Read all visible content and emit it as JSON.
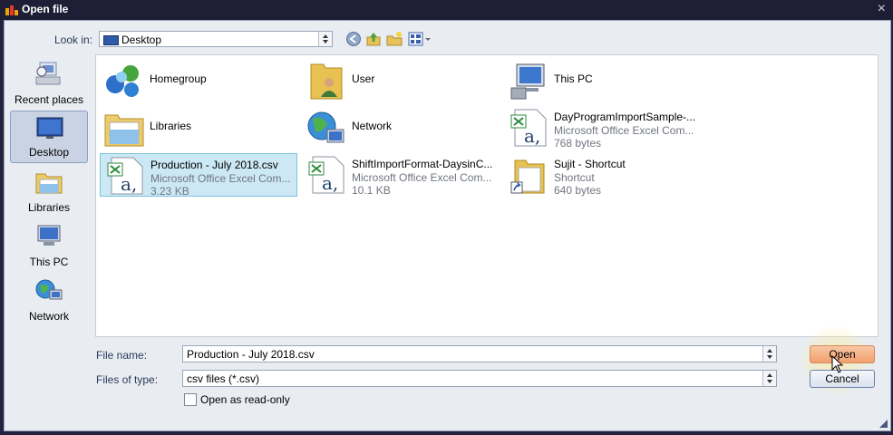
{
  "window": {
    "title": "Open file",
    "close_glyph": "×"
  },
  "lookin": {
    "label": "Look in:",
    "value": "Desktop"
  },
  "toolbar": {
    "back_icon": "back-icon",
    "up_icon": "up-folder-icon",
    "new_icon": "new-folder-icon",
    "view_icon": "view-menu-icon"
  },
  "places": [
    {
      "label": "Recent places",
      "icon": "recent-places-icon"
    },
    {
      "label": "Desktop",
      "icon": "desktop-icon"
    },
    {
      "label": "Libraries",
      "icon": "libraries-icon"
    },
    {
      "label": "This PC",
      "icon": "computer-icon"
    },
    {
      "label": "Network",
      "icon": "network-icon"
    }
  ],
  "files": [
    {
      "name": "Homegroup",
      "line2": "",
      "line3": "",
      "icon": "homegroup-icon"
    },
    {
      "name": "User",
      "line2": "",
      "line3": "",
      "icon": "user-folder-icon"
    },
    {
      "name": "This PC",
      "line2": "",
      "line3": "",
      "icon": "computer-icon"
    },
    {
      "name": "Libraries",
      "line2": "",
      "line3": "",
      "icon": "libraries-icon"
    },
    {
      "name": "Network",
      "line2": "",
      "line3": "",
      "icon": "network-icon"
    },
    {
      "name": "DayProgramImportSample-...",
      "line2": "Microsoft Office Excel Com...",
      "line3": "768 bytes",
      "icon": "excel-csv-icon"
    },
    {
      "name": "Production - July 2018.csv",
      "line2": "Microsoft Office Excel Com...",
      "line3": "3.23 KB",
      "icon": "excel-csv-icon"
    },
    {
      "name": "ShiftImportFormat-DaysinC...",
      "line2": "Microsoft Office Excel Com...",
      "line3": "10.1 KB",
      "icon": "excel-csv-icon"
    },
    {
      "name": "Sujit - Shortcut",
      "line2": "Shortcut",
      "line3": "640 bytes",
      "icon": "shortcut-icon"
    }
  ],
  "filename": {
    "label": "File name:",
    "value": "Production - July 2018.csv"
  },
  "filetype": {
    "label": "Files of type:",
    "value": "csv files (*.csv)"
  },
  "readonly": {
    "label": "Open as read-only",
    "checked": false
  },
  "buttons": {
    "open": "Open",
    "cancel": "Cancel"
  },
  "colors": {
    "title_bar": "#1e1e36",
    "selection": "#cce8f4",
    "open_button": "#f2a06e"
  }
}
